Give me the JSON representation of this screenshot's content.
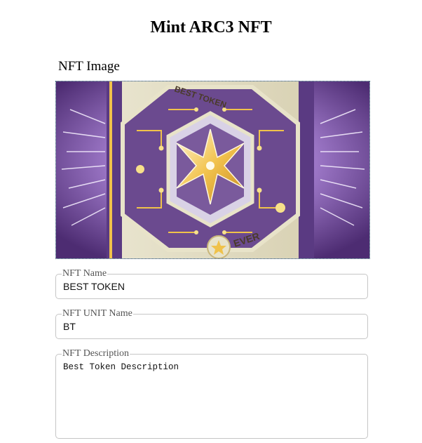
{
  "page": {
    "title": "Mint ARC3 NFT"
  },
  "image_section": {
    "label": "NFT Image",
    "image_text_top": "BEST TOKEN",
    "image_text_bottom": "EVER"
  },
  "fields": {
    "name": {
      "label": "NFT Name",
      "value": "BEST TOKEN"
    },
    "unit_name": {
      "label": "NFT UNIT Name",
      "value": "BT"
    },
    "description": {
      "label": "NFT Description",
      "value": "Best Token Description"
    }
  },
  "colors": {
    "purple": "#6b4a8f",
    "gold": "#f0c24a",
    "cream": "#e8e3c9"
  }
}
